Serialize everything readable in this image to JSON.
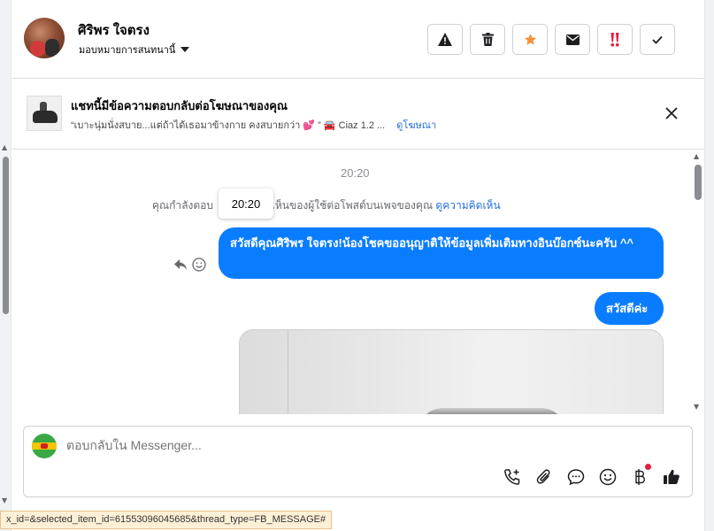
{
  "header": {
    "contact_name": "ศิริพร ใจตรง",
    "assign_label": "มอบหมายการสนทนานี้",
    "actions": [
      {
        "name": "report-spam",
        "icon": "warning-triangle-icon"
      },
      {
        "name": "delete",
        "icon": "trash-icon"
      },
      {
        "name": "star",
        "icon": "star-icon",
        "color": "#f7923b"
      },
      {
        "name": "mark-unread",
        "icon": "envelope-icon"
      },
      {
        "name": "follow-up",
        "icon": "double-exclamation-icon",
        "color": "#e41e3f"
      },
      {
        "name": "mark-done",
        "icon": "checkmark-icon"
      }
    ]
  },
  "ad_bar": {
    "title": "แชทนี้มีข้อความตอบกลับต่อโฆษณาของคุณ",
    "description": "“เบาะนุ่มนั่งสบาย...แต่ถ้าได้เธอมาข้างกาย คงสบายกว่า 💕 ” 🚘 Ciaz 1.2 ...",
    "link": "ดูโฆษณา"
  },
  "chat": {
    "timestamp": "20:20",
    "tooltip_time": "20:20",
    "notice_text_a": "คุณกำลังตอบ",
    "notice_text_b": "ิดเห็นของผู้ใช้ต่อโพสต์บนเพจของคุณ",
    "notice_link": "ดูความคิดเห็น",
    "messages": [
      {
        "text": "สวัสดีคุณศิริพร ใจตรง!น้องโชคขออนุญาติให้ข้อมูลเพิ่มเติมทางอินบ๊อกซ์นะครับ ^^",
        "from": "page"
      },
      {
        "text": "สวัสดีค่ะ",
        "from": "page"
      }
    ]
  },
  "composer": {
    "placeholder": "ตอบกลับใน Messenger...",
    "tools": [
      "phone-plus-icon",
      "paperclip-icon",
      "chat-bubble-icon",
      "emoji-icon",
      "currency-icon",
      "thumbs-up-icon"
    ]
  },
  "status_bar": {
    "url": "x_id=&selected_item_id=61553096045685&thread_type=FB_MESSAGE#"
  },
  "colors": {
    "brand_blue": "#0a7cff",
    "link_blue": "#216fdb",
    "star_orange": "#f7923b",
    "alert_red": "#e41e3f"
  }
}
